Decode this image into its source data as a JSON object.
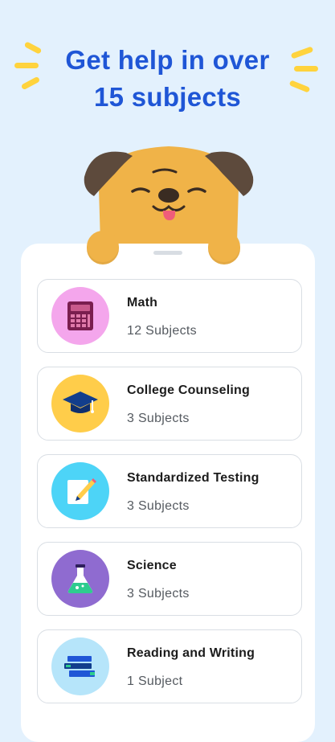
{
  "header": {
    "line1": "Get help in over",
    "line2": "15 subjects"
  },
  "colors": {
    "background": "#e3f1fd",
    "headline": "#1f56d6",
    "accent_yellow": "#ffd33d"
  },
  "subjects": [
    {
      "title": "Math",
      "count": "12 Subjects",
      "icon": "calculator-icon",
      "circle_color": "#f4a6ec"
    },
    {
      "title": "College Counseling",
      "count": "3 Subjects",
      "icon": "graduation-cap-icon",
      "circle_color": "#ffcd4a"
    },
    {
      "title": "Standardized Testing",
      "count": "3 Subjects",
      "icon": "test-paper-pencil-icon",
      "circle_color": "#4dd4f7"
    },
    {
      "title": "Science",
      "count": "3 Subjects",
      "icon": "flask-icon",
      "circle_color": "#8f6bd0"
    },
    {
      "title": "Reading and Writing",
      "count": "1 Subject",
      "icon": "books-icon",
      "circle_color": "#b6e5fa"
    }
  ]
}
